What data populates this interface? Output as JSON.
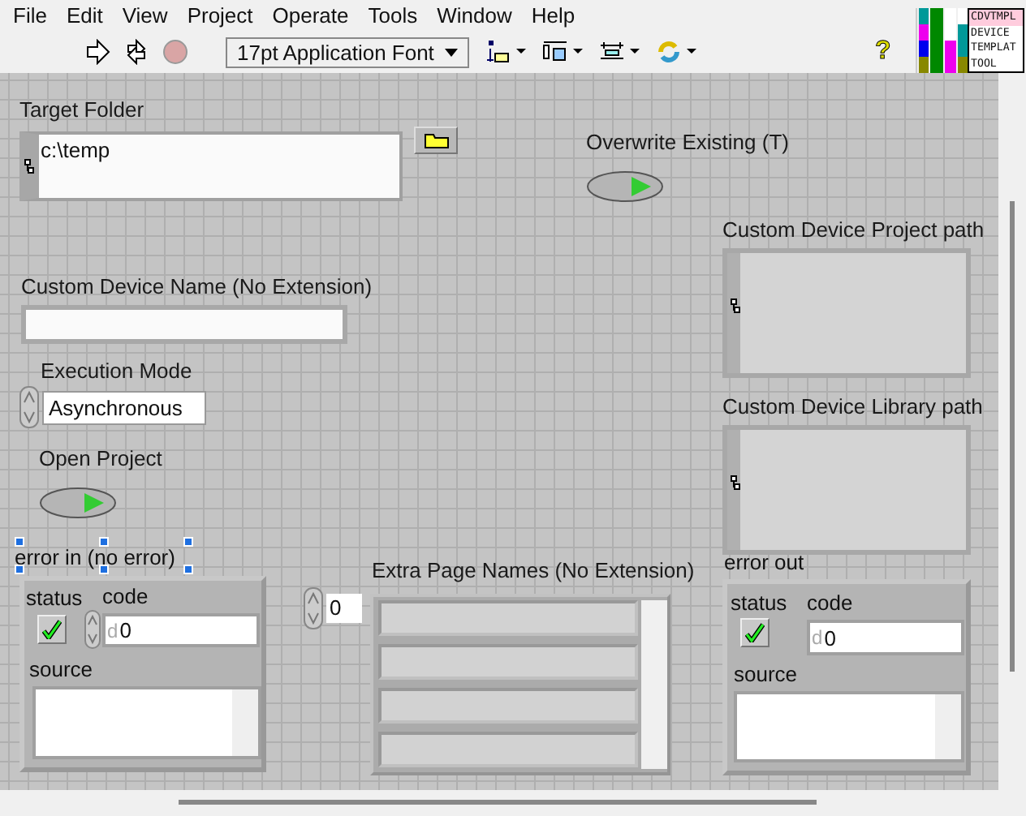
{
  "menu": [
    "File",
    "Edit",
    "View",
    "Project",
    "Operate",
    "Tools",
    "Window",
    "Help"
  ],
  "toolbar": {
    "font": "17pt Application Font",
    "help": "?"
  },
  "vi_icon": {
    "lines": [
      "CDVTMPL",
      "DEVICE",
      "TEMPLAT",
      "TOOL"
    ]
  },
  "target_folder": {
    "label": "Target Folder",
    "value": "c:\\temp"
  },
  "overwrite_existing": {
    "label": "Overwrite Existing (T)",
    "on": false
  },
  "custom_device_name": {
    "label": "Custom Device Name (No Extension)"
  },
  "execution_mode": {
    "label": "Execution Mode",
    "value": "Asynchronous"
  },
  "open_project": {
    "label": "Open Project",
    "on": false
  },
  "project_path": {
    "label": "Custom Device Project path"
  },
  "library_path": {
    "label": "Custom Device Library path"
  },
  "error_in": {
    "label": "error in (no error)",
    "selected": true,
    "status_label": "status",
    "checked": true,
    "code_label": "code",
    "radix": "d",
    "code": "0",
    "source_label": "source"
  },
  "extra_pages": {
    "label": "Extra Page Names (No Extension)",
    "index": "0",
    "elements": [
      {
        "kind": "empty"
      },
      {
        "kind": "empty"
      },
      {
        "kind": "empty"
      },
      {
        "kind": "empty"
      }
    ]
  },
  "error_out": {
    "label": "error out",
    "selected": false,
    "status_label": "status",
    "checked": true,
    "code_label": "code",
    "radix": "d",
    "code": "0",
    "source_label": "source"
  }
}
